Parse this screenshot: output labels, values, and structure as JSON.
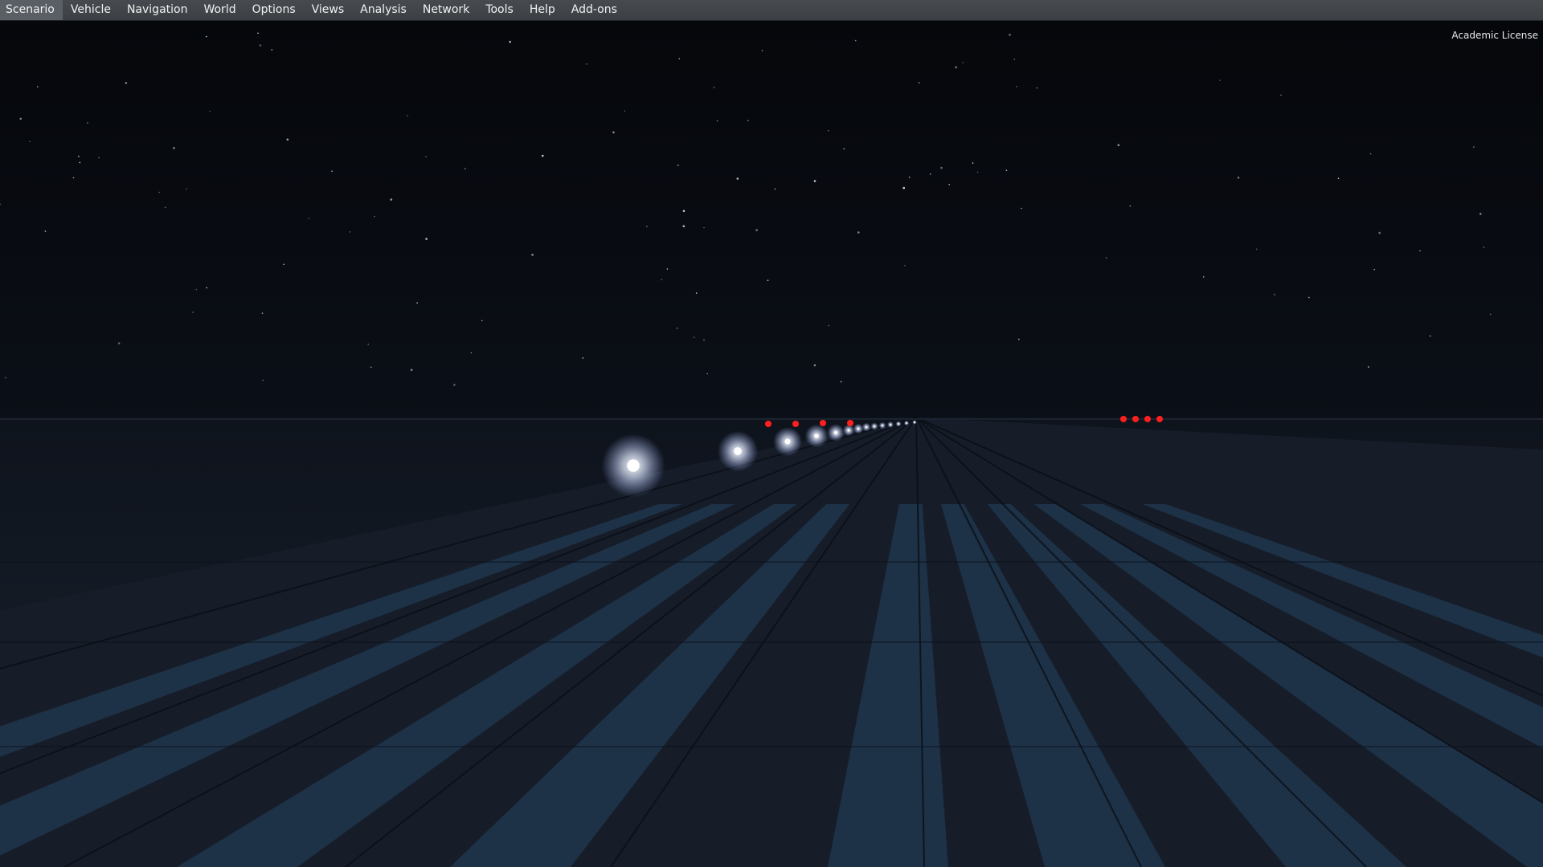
{
  "menu": {
    "items": [
      {
        "label": "Scenario",
        "name": "menu-scenario"
      },
      {
        "label": "Vehicle",
        "name": "menu-vehicle"
      },
      {
        "label": "Navigation",
        "name": "menu-navigation"
      },
      {
        "label": "World",
        "name": "menu-world"
      },
      {
        "label": "Options",
        "name": "menu-options"
      },
      {
        "label": "Views",
        "name": "menu-views"
      },
      {
        "label": "Analysis",
        "name": "menu-analysis"
      },
      {
        "label": "Network",
        "name": "menu-network"
      },
      {
        "label": "Tools",
        "name": "menu-tools"
      },
      {
        "label": "Help",
        "name": "menu-help"
      },
      {
        "label": "Add-ons",
        "name": "menu-addons"
      }
    ]
  },
  "overlay": {
    "license_text": "Academic License"
  },
  "scene": {
    "description_free": true,
    "colors": {
      "sky": "#05070b",
      "runway": "#1a2230",
      "stripe": "#1f3a52",
      "edge_light": "#ffffff",
      "red_light": "#ff1a1a",
      "menubar": "#414549"
    }
  }
}
